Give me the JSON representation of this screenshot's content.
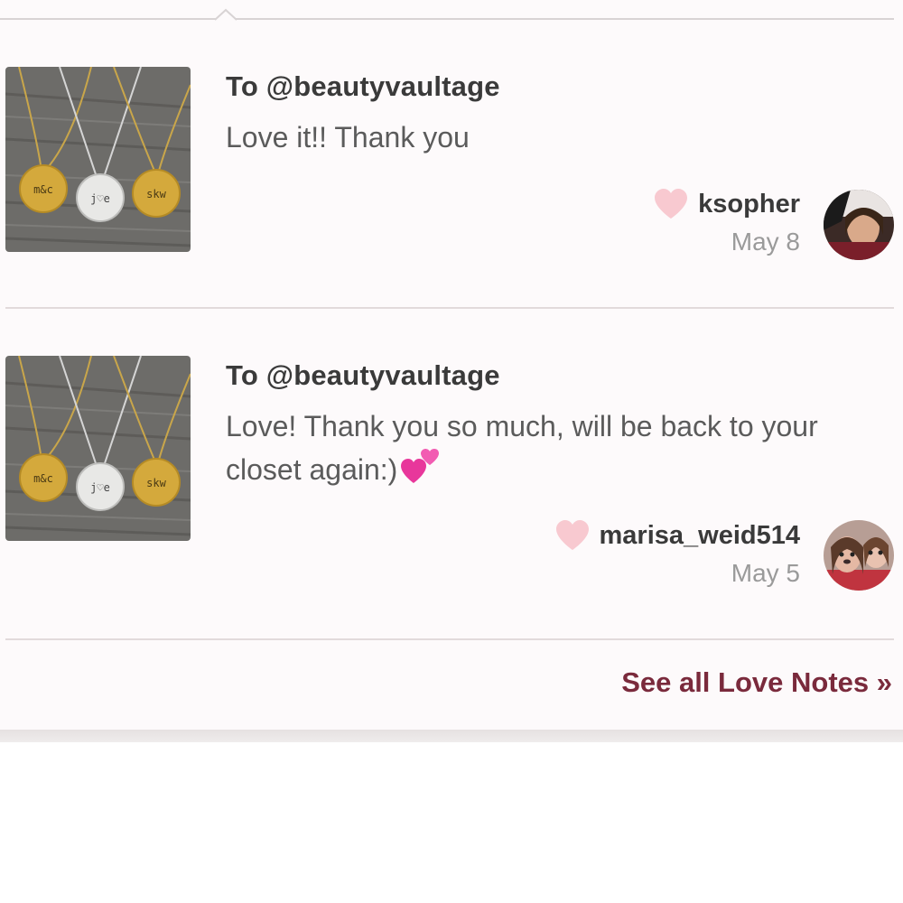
{
  "notes": [
    {
      "recipient": "To @beautyvaultage",
      "message": "Love it!! Thank you",
      "message_emoji": "",
      "username": "ksopher",
      "date": "May 8",
      "icons": {
        "like": "heart-icon",
        "thumbnail": "necklace-product-thumbnail",
        "avatar": "user-avatar"
      }
    },
    {
      "recipient": "To @beautyvaultage",
      "message": "Love! Thank you so much, will be back to your closet again:)",
      "message_emoji": "two-hearts-emoji",
      "username": "marisa_weid514",
      "date": "May 5",
      "icons": {
        "like": "heart-icon",
        "thumbnail": "necklace-product-thumbnail",
        "avatar": "user-avatar"
      }
    }
  ],
  "footer": {
    "see_all_label": "See all Love Notes »"
  },
  "thumbnail_pendants": [
    "m&c",
    "j♡e",
    "skw"
  ],
  "colors": {
    "like_heart": "#f8c9d0",
    "see_all_link": "#7a2a3c",
    "panel_bg": "#fdfafb",
    "emoji_heart": "#e8379b"
  }
}
